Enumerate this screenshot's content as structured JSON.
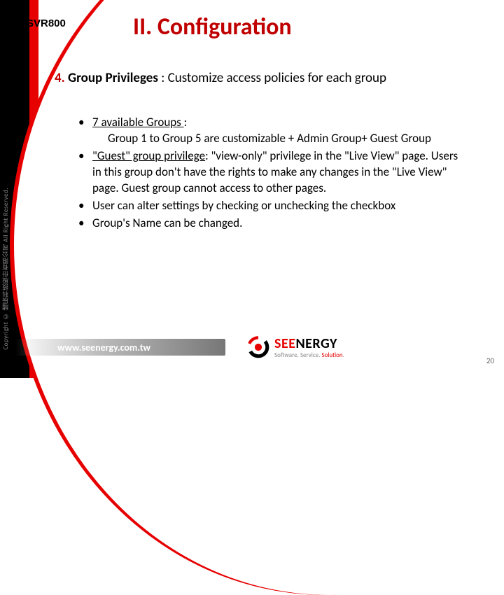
{
  "product": "SVR800",
  "title": "II.    Configuration",
  "section": {
    "number": "4.",
    "label": "Group Privileges",
    "desc": ": Customize access policies for each group"
  },
  "bullets": {
    "b1_lead": "7 available Groups ",
    "b1_colon": ":",
    "b1_sub": "Group 1 to Group 5 are customizable + Admin Group+ Guest Group",
    "b2_lead": "\"Guest\" group privilege",
    "b2_rest": ": \"view-only\" privilege in the \"Live View\" page. Users in this group don't have the rights to make any changes in the \"Live View\" page. Guest group cannot access to other pages.",
    "b3": "User can alter settings by checking or unchecking the checkbox",
    "b4": "Group's Name can be changed."
  },
  "footer": {
    "url": "www.seenergy.com.tw",
    "brand_a": "SEE",
    "brand_b": "NERGY",
    "tagline_a": "Software. Service. ",
    "tagline_b": "Solution",
    "tagline_c": "."
  },
  "side": "Copyright © 緒辰科技股份有限公司 All Right Reserved.",
  "page": "20"
}
